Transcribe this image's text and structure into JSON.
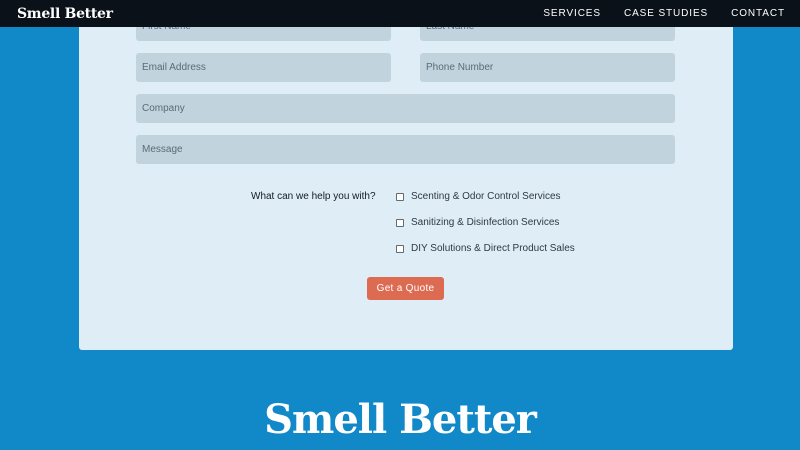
{
  "header": {
    "logo": "Smell Better",
    "nav": [
      "SERVICES",
      "CASE STUDIES",
      "CONTACT"
    ]
  },
  "form": {
    "first_name_placeholder": "First Name",
    "last_name_placeholder": "Last Name",
    "email_placeholder": "Email Address",
    "phone_placeholder": "Phone Number",
    "company_placeholder": "Company",
    "message_placeholder": "Message",
    "help_label": "What can we help you with?",
    "options": [
      "Scenting & Odor Control Services",
      "Sanitizing & Disinfection Services",
      "DIY Solutions & Direct Product Sales"
    ],
    "submit_label": "Get a Quote"
  },
  "footer": {
    "logo": "Smell Better"
  },
  "colors": {
    "page_background": "#1188c8",
    "nav_background": "#0b1118",
    "card_background": "#dfedf7",
    "field_background": "#c1d3dd",
    "button": "#dd6b52"
  }
}
